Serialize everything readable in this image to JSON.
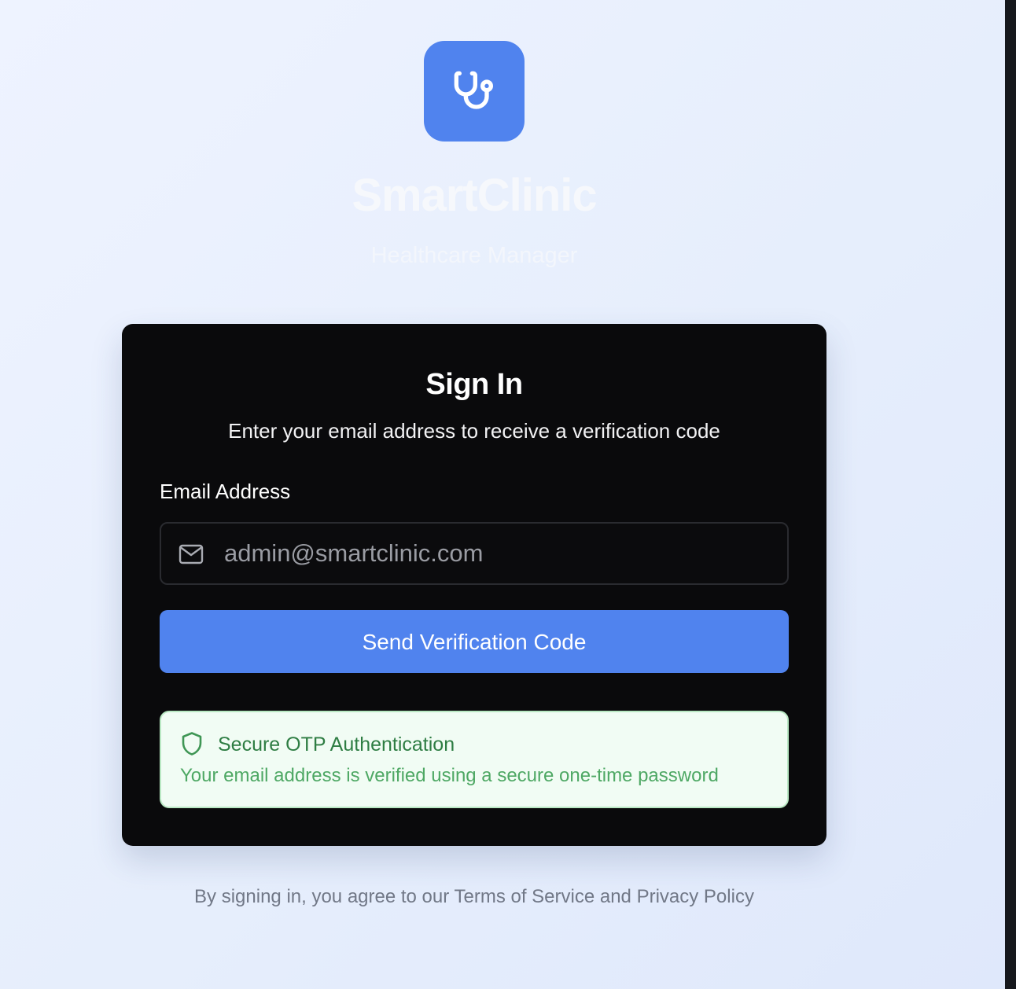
{
  "brand": {
    "name": "SmartClinic",
    "tagline": "Healthcare Manager",
    "logo_icon": "stethoscope-icon",
    "accent_color": "#5083ee"
  },
  "sign_in": {
    "title": "Sign In",
    "subtitle": "Enter your email address to receive a verification code",
    "email_label": "Email Address",
    "email_placeholder": "admin@smartclinic.com",
    "email_value": "",
    "email_icon": "mail-icon",
    "submit_label": "Send Verification Code"
  },
  "security_notice": {
    "icon": "shield-icon",
    "title": "Secure OTP Authentication",
    "description": "Your email address is verified using a secure one-time password"
  },
  "footer": {
    "text": "By signing in, you agree to our Terms of Service and Privacy Policy"
  }
}
